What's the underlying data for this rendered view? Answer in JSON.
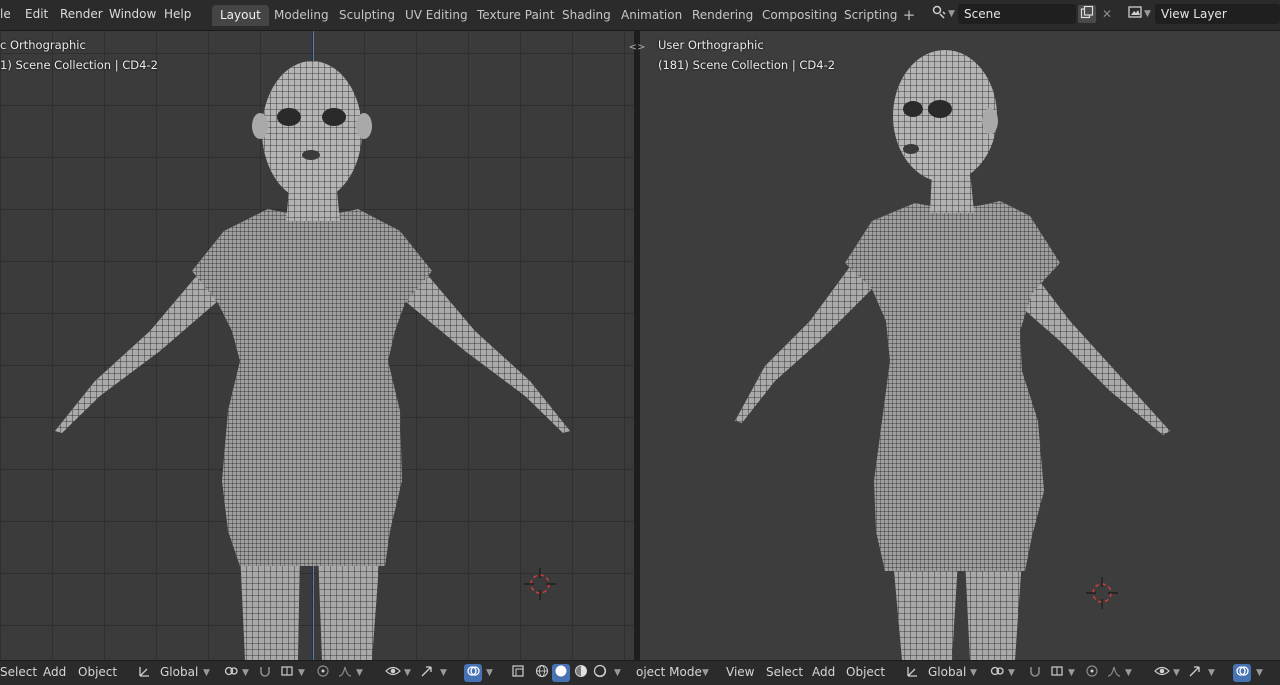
{
  "menus": [
    "le",
    "Edit",
    "Render",
    "Window",
    "Help"
  ],
  "workspace_tabs": [
    "Layout",
    "Modeling",
    "Sculpting",
    "UV Editing",
    "Texture Paint",
    "Shading",
    "Animation",
    "Rendering",
    "Compositing",
    "Scripting"
  ],
  "active_tab": "Layout",
  "scene": {
    "name": "Scene"
  },
  "view_layer": {
    "name": "View Layer"
  },
  "left_viewport": {
    "view_name": "c Orthographic",
    "collection": "1) Scene Collection | CD4-2"
  },
  "right_viewport": {
    "view_name": "User Orthographic",
    "collection": "(181) Scene Collection | CD4-2"
  },
  "left_header": {
    "select": "Select",
    "add": "Add",
    "object": "Object",
    "orientation": "Global"
  },
  "right_header": {
    "mode": "oject Mode",
    "view": "View",
    "select": "Select",
    "add": "Add",
    "object": "Object",
    "orientation": "Global"
  },
  "icons": {
    "add_workspace": "+",
    "scene_icon": "scene-icon",
    "copy_icon": "copy-icon",
    "close_icon": "close-icon",
    "view_layer_icon": "view-layer-icon",
    "split_handle": "<>"
  },
  "colors": {
    "accent": "#4772b3",
    "z_axis": "#4d7fb8",
    "cursor_red": "#d23c3c"
  }
}
